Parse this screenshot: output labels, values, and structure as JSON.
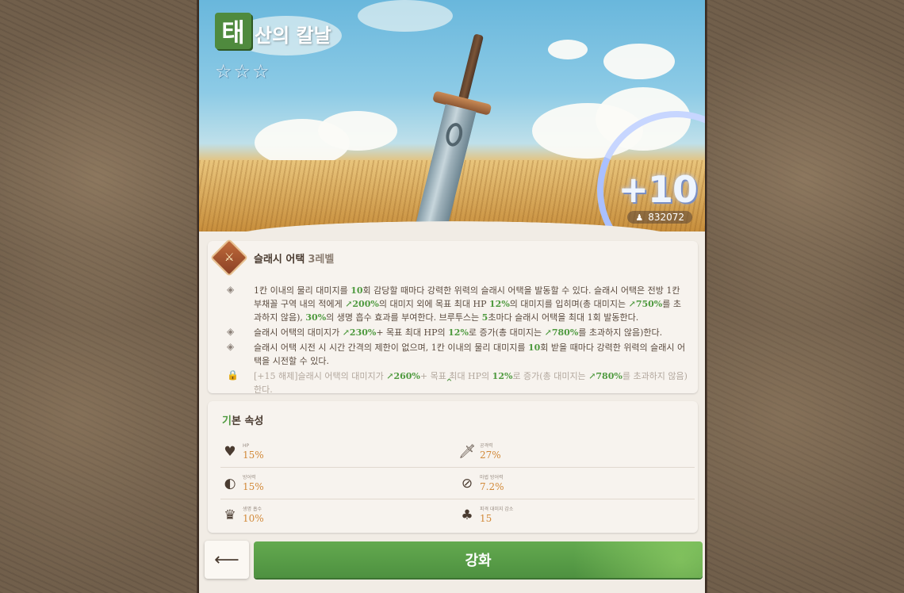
{
  "item": {
    "title_first_char": "태",
    "title_rest": "산의 칼날",
    "stars": [
      "☆",
      "☆",
      "☆"
    ],
    "enhance_level": "+10",
    "power_icon": "♟",
    "power_value": "832072"
  },
  "skill": {
    "icon": "⚔",
    "name": "슬래시 어택",
    "level": "3레벨",
    "bullet_icon": "◈",
    "lock_icon": "🔒",
    "lines": [
      {
        "parts": [
          {
            "t": "1칸 이내의 물리 대미지를 "
          },
          {
            "t": "10",
            "g": true
          },
          {
            "t": "회 감당할 때마다 강력한 위력의 슬래시 어택을 발동할 수 있다. 슬래시 어택은 전방 1칸 부채꼴 구역 내의 적에게 "
          },
          {
            "t": "↗200%",
            "g": true
          },
          {
            "t": "의 대미지 외에 목표 최대 HP "
          },
          {
            "t": "12%",
            "g": true
          },
          {
            "t": "의 대미지를 입히며(총 대미지는 "
          },
          {
            "t": "↗750%",
            "g": true
          },
          {
            "t": "를 초과하지 않음), "
          },
          {
            "t": "30%",
            "g": true
          },
          {
            "t": "의 생명 흡수 효과를 부여한다. 브루투스는 "
          },
          {
            "t": "5",
            "g": true
          },
          {
            "t": "초마다 슬래시 어택을 최대 1회 발동한다."
          }
        ]
      },
      {
        "parts": [
          {
            "t": "슬래시 어택의 대미지가 "
          },
          {
            "t": "↗230%",
            "g": true
          },
          {
            "t": "+ 목표 최대 HP의 "
          },
          {
            "t": "12%",
            "g": true
          },
          {
            "t": "로 증가(총 대미지는 "
          },
          {
            "t": "↗780%",
            "g": true
          },
          {
            "t": "를 초과하지 않음)한다."
          }
        ]
      },
      {
        "parts": [
          {
            "t": "슬래시 어택 시전 시 시간 간격의 제한이 없으며, 1칸 이내의 물리 대미지를 "
          },
          {
            "t": "10",
            "g": true
          },
          {
            "t": "회 받을 때마다 강력한 위력의 슬래시 어택을 시전할 수 있다."
          }
        ]
      },
      {
        "locked": true,
        "parts": [
          {
            "t": "[+15 해제]슬래시 어택의 대미지가 "
          },
          {
            "t": "↗260%",
            "g": true
          },
          {
            "t": "+ 목표 최대 HP의 "
          },
          {
            "t": "12%",
            "g": true
          },
          {
            "t": "로 증가(총 대미지는 "
          },
          {
            "t": "↗780%",
            "g": true
          },
          {
            "t": "를 초과하지 않음)한다."
          }
        ]
      }
    ],
    "collapse_icon": "⌃"
  },
  "attributes": {
    "title_first": "기",
    "title_rest": "본 속성",
    "rows": [
      [
        {
          "icon": "♥",
          "icon_name": "hp-icon",
          "label": "HP",
          "value": "15%"
        },
        {
          "icon": "🗡",
          "icon_name": "attack-icon",
          "label": "공격력",
          "value": "27%"
        }
      ],
      [
        {
          "icon": "◐",
          "icon_name": "defense-icon",
          "label": "방어력",
          "value": "15%"
        },
        {
          "icon": "⊘",
          "icon_name": "magic-defense-icon",
          "label": "마법 방어력",
          "value": "7.2%"
        }
      ],
      [
        {
          "icon": "♛",
          "icon_name": "lifesteal-icon",
          "label": "생명 흡수",
          "value": "10%"
        },
        {
          "icon": "♣",
          "icon_name": "damage-reduction-icon",
          "label": "피격 대미지 감소",
          "value": "15"
        }
      ]
    ]
  },
  "buttons": {
    "back_icon": "⟵",
    "enhance_label": "강화"
  }
}
